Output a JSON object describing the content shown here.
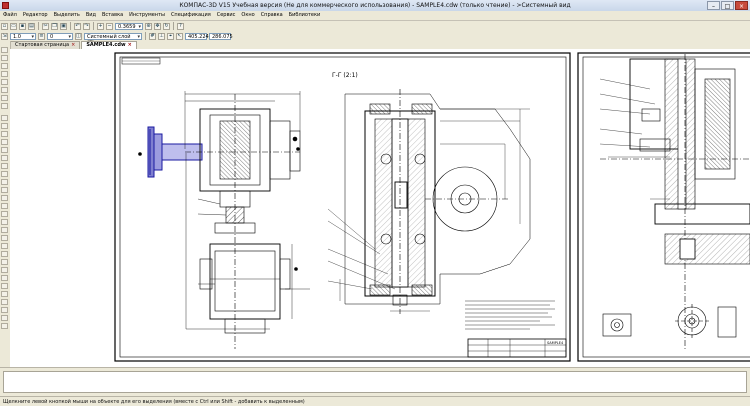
{
  "window": {
    "title": "КОМПАС-3D V15 Учебная версия (Не для коммерческого использования) - SAMPLE4.cdw (только чтение) - >Системный вид"
  },
  "menu": [
    "Файл",
    "Редактор",
    "Выделить",
    "Вид",
    "Вставка",
    "Инструменты",
    "Спецификация",
    "Сервис",
    "Окно",
    "Справка",
    "Библиотеки"
  ],
  "toolbar": {
    "scale_value": "1.0",
    "layer_value": "0",
    "view_value": "Системный слой (0)",
    "zoom_value": "0.3659",
    "coord_x": "405.224",
    "coord_y": "286.075"
  },
  "tabs": [
    {
      "label": "Стартовая страница"
    },
    {
      "label": "SAMPLE4.cdw"
    }
  ],
  "status": {
    "hint": "Щелкните левой кнопкой мыши на объекте для его выделения (вместе с Ctrl или Shift - добавить к выделенным)"
  },
  "drawing": {
    "section_label": "Г-Г (2:1)",
    "stamp_title": "SAMPLE4",
    "line_color": "#000000",
    "hatch_color": "#000000",
    "accent_color": "#1a1aa0"
  }
}
